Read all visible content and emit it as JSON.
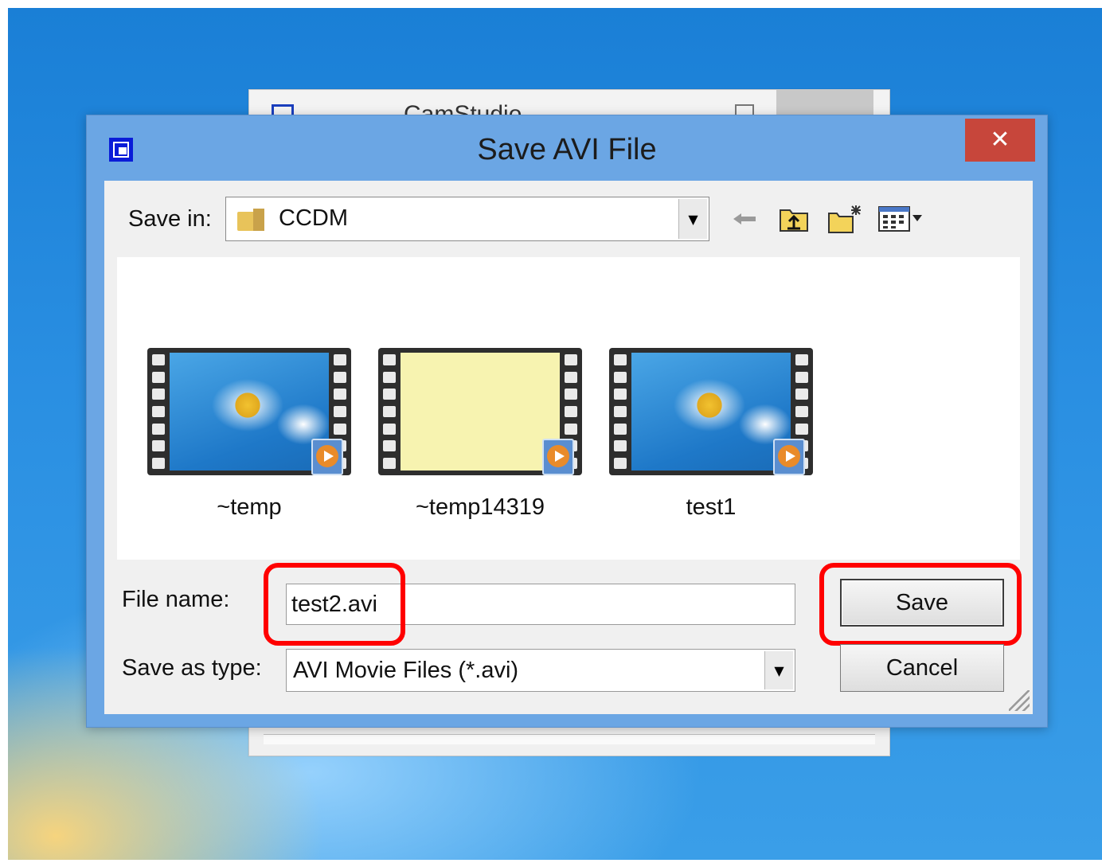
{
  "dialog": {
    "title": "Save AVI File",
    "close_label": "✕"
  },
  "save_in": {
    "label": "Save in:",
    "value": "CCDM"
  },
  "toolbar": {
    "back_icon": "back-arrow-icon",
    "up_icon": "up-folder-icon",
    "new_folder_icon": "new-folder-icon",
    "view_icon": "view-menu-icon"
  },
  "files": [
    {
      "name": "~temp",
      "thumbnail": "desktop"
    },
    {
      "name": "~temp14319",
      "thumbnail": "yellow"
    },
    {
      "name": "test1",
      "thumbnail": "desktop"
    }
  ],
  "file_name": {
    "label": "File name:",
    "value": "test2.avi"
  },
  "save_as_type": {
    "label": "Save as type:",
    "value": "AVI Movie Files (*.avi)"
  },
  "buttons": {
    "save": "Save",
    "cancel": "Cancel"
  },
  "colors": {
    "highlight": "#ff0000",
    "title_bar": "#6ba6e4",
    "close_button": "#c7463b"
  }
}
